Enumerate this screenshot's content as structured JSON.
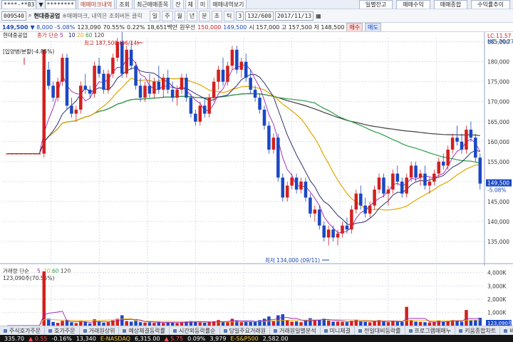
{
  "toolbar": {
    "account_field": "****-**83",
    "password_field": "********",
    "buttons": [
      {
        "label": "매매마크내역",
        "style": "red"
      },
      {
        "label": "조회",
        "style": ""
      },
      {
        "label": "최근매매종목",
        "style": ""
      },
      {
        "label": "잔",
        "style": ""
      },
      {
        "label": "체",
        "style": ""
      },
      {
        "label": "미",
        "style": ""
      },
      {
        "label": "매매내역보기",
        "style": ""
      }
    ],
    "right_buttons": [
      "일별잔고",
      "매매수익",
      "매매종합",
      "수익률추이"
    ]
  },
  "stockbar": {
    "code": "009540",
    "name": "현대중공업",
    "note": "※매매마크, 내역은 조회버튼 클릭",
    "period_buttons": [
      "일",
      "주",
      "월",
      "년",
      "분",
      "초",
      "틱"
    ],
    "period_value": "3",
    "count": "132/600",
    "date": "2017/11/13"
  },
  "pricebar": {
    "price": "149,500",
    "change": "▼ 8,000",
    "change_pct": "-5.08%",
    "volume": "123,090",
    "volume_ratio": "70.55%",
    "turnover_ratio": "0.22%",
    "amount": "18,651백만",
    "upper": "원우선",
    "open": "150,000",
    "low_label": "149,500",
    "high_info": "시 157,000 고 157,500 저 148,500",
    "buy_label": "매수",
    "sell_label": "매도"
  },
  "colors": {
    "up": "#d22020",
    "down": "#1a48c4",
    "ma5": "#a020b0",
    "ma10": "#1a1a60",
    "ma20": "#e0a800",
    "ma60": "#2e9b44",
    "ma120": "#404040",
    "grid": "#d7dce6"
  },
  "chart_data": {
    "type": "candlestick",
    "stock": "현대중공업",
    "legend": [
      {
        "label": "현대중공업",
        "color": "#222222"
      },
      {
        "label": "종가 단순",
        "color": "#c81e1e"
      },
      {
        "label": "5",
        "color": "#a020b0"
      },
      {
        "label": "10",
        "color": "#1a1a60"
      },
      {
        "label": "20",
        "color": "#e0a800"
      },
      {
        "label": "60",
        "color": "#2e9b44"
      },
      {
        "label": "120",
        "color": "#404040"
      }
    ],
    "price_axis": {
      "min": 130000,
      "max": 186000,
      "ticks": [
        135000,
        140000,
        145000,
        150000,
        155000,
        160000,
        165000,
        170000,
        175000,
        180000,
        185000
      ]
    },
    "price_tick_labels": [
      "135,000",
      "140,000",
      "145,000",
      "150,000",
      "155,000",
      "160,000",
      "165,000",
      "170,000",
      "175,000",
      "180,000",
      "185,000"
    ],
    "top_labels": [
      "LC:11.57",
      "HC:-20.27"
    ],
    "annotation_high": "최고 187,500 (06/14)",
    "annotation_low": "최저 134,000 (09/11)",
    "annotation_event": "[입양병/분할(-4.85%)",
    "current_price_label": "149,500",
    "current_change_label": "-5.08%",
    "candles": [
      [
        157,
        157,
        157,
        157
      ],
      [
        157,
        157,
        157,
        157
      ],
      [
        157,
        157,
        157,
        157
      ],
      [
        157,
        157,
        157,
        157
      ],
      [
        157,
        157,
        157,
        157
      ],
      [
        157,
        157,
        157,
        157
      ],
      [
        157,
        157,
        157,
        157
      ],
      [
        157,
        157,
        157,
        157
      ],
      [
        157,
        183,
        156,
        183
      ],
      [
        178,
        180,
        173,
        174
      ],
      [
        174,
        175,
        170,
        171
      ],
      [
        171,
        176,
        170,
        175
      ],
      [
        175,
        182,
        174,
        181
      ],
      [
        181,
        182,
        168,
        169
      ],
      [
        169,
        171,
        166,
        167
      ],
      [
        167,
        169,
        165,
        168
      ],
      [
        168,
        175,
        167,
        174
      ],
      [
        174,
        177,
        172,
        173
      ],
      [
        173,
        174,
        171,
        172
      ],
      [
        172,
        180,
        171,
        179
      ],
      [
        179,
        181,
        176,
        177
      ],
      [
        177,
        178,
        172,
        173
      ],
      [
        173,
        178,
        172,
        177
      ],
      [
        177,
        182,
        176,
        181
      ],
      [
        181,
        186,
        180,
        185
      ],
      [
        185,
        188,
        176,
        177
      ],
      [
        177,
        184,
        176,
        183
      ],
      [
        183,
        185,
        178,
        179
      ],
      [
        179,
        180,
        173,
        174
      ],
      [
        174,
        176,
        170,
        171
      ],
      [
        171,
        175,
        170,
        174
      ],
      [
        174,
        177,
        171,
        172
      ],
      [
        172,
        176,
        171,
        175
      ],
      [
        175,
        179,
        172,
        173
      ],
      [
        173,
        177,
        171,
        176
      ],
      [
        176,
        178,
        172,
        173
      ],
      [
        173,
        175,
        170,
        171
      ],
      [
        171,
        174,
        169,
        173
      ],
      [
        173,
        177,
        172,
        176
      ],
      [
        176,
        177,
        170,
        171
      ],
      [
        171,
        172,
        166,
        167
      ],
      [
        167,
        168,
        164,
        165
      ],
      [
        165,
        170,
        164,
        169
      ],
      [
        169,
        171,
        166,
        167
      ],
      [
        167,
        172,
        166,
        171
      ],
      [
        171,
        176,
        170,
        175
      ],
      [
        175,
        179,
        173,
        178
      ],
      [
        178,
        181,
        174,
        175
      ],
      [
        175,
        180,
        174,
        179
      ],
      [
        179,
        184,
        178,
        183
      ],
      [
        183,
        184,
        177,
        178
      ],
      [
        178,
        181,
        176,
        180
      ],
      [
        180,
        182,
        175,
        176
      ],
      [
        176,
        178,
        172,
        173
      ],
      [
        173,
        174,
        170,
        171
      ],
      [
        171,
        172,
        167,
        168
      ],
      [
        168,
        169,
        163,
        164
      ],
      [
        164,
        165,
        157,
        158
      ],
      [
        158,
        162,
        157,
        161
      ],
      [
        161,
        162,
        150,
        151
      ],
      [
        151,
        152,
        145,
        146
      ],
      [
        146,
        150,
        145,
        149
      ],
      [
        149,
        152,
        148,
        151
      ],
      [
        151,
        152,
        147,
        148
      ],
      [
        148,
        151,
        147,
        150
      ],
      [
        150,
        151,
        145,
        146
      ],
      [
        146,
        147,
        141,
        142
      ],
      [
        142,
        144,
        140,
        143
      ],
      [
        143,
        144,
        138,
        139
      ],
      [
        139,
        140,
        135,
        136
      ],
      [
        136,
        139,
        134,
        138
      ],
      [
        138,
        139,
        135,
        136
      ],
      [
        136,
        138,
        134,
        137
      ],
      [
        137,
        140,
        136,
        139
      ],
      [
        139,
        141,
        137,
        138
      ],
      [
        138,
        144,
        137,
        143
      ],
      [
        143,
        148,
        142,
        147
      ],
      [
        147,
        149,
        143,
        144
      ],
      [
        144,
        146,
        141,
        142
      ],
      [
        142,
        145,
        141,
        144
      ],
      [
        144,
        149,
        143,
        148
      ],
      [
        148,
        152,
        147,
        151
      ],
      [
        151,
        152,
        146,
        147
      ],
      [
        147,
        149,
        144,
        148
      ],
      [
        148,
        153,
        147,
        152
      ],
      [
        152,
        154,
        149,
        150
      ],
      [
        150,
        151,
        146,
        147
      ],
      [
        147,
        152,
        146,
        151
      ],
      [
        151,
        155,
        150,
        154
      ],
      [
        154,
        155,
        150,
        151
      ],
      [
        151,
        153,
        149,
        152
      ],
      [
        152,
        154,
        148,
        149
      ],
      [
        149,
        151,
        147,
        150
      ],
      [
        150,
        153,
        149,
        152
      ],
      [
        152,
        156,
        151,
        155
      ],
      [
        155,
        157,
        153,
        154
      ],
      [
        154,
        159,
        153,
        158
      ],
      [
        158,
        162,
        157,
        161
      ],
      [
        161,
        164,
        159,
        160
      ],
      [
        160,
        162,
        157,
        158
      ],
      [
        158,
        164,
        157,
        163
      ],
      [
        163,
        165,
        160,
        161
      ],
      [
        161,
        162,
        155,
        156
      ],
      [
        156,
        157,
        148,
        149.5
      ]
    ]
  },
  "volume_panel": {
    "title": "거래량 단순",
    "legend": [
      {
        "label": "5",
        "color": "#a020b0"
      },
      {
        "label": "20",
        "color": "#e0a800"
      },
      {
        "label": "60",
        "color": "#2e9b44"
      },
      {
        "label": "120",
        "color": "#404040"
      }
    ],
    "info": "123,090주(70.55%)",
    "axis_labels": [
      "4,000K",
      "3,000K",
      "2,000K",
      "1,000K"
    ],
    "current_label": "123,090주",
    "max_value": 4200,
    "values": [
      0,
      0,
      0,
      0,
      0,
      0,
      0,
      0,
      4100,
      520,
      280,
      210,
      360,
      420,
      250,
      190,
      330,
      270,
      160,
      480,
      310,
      220,
      260,
      390,
      520,
      780,
      340,
      300,
      410,
      260,
      230,
      250,
      210,
      280,
      200,
      240,
      230,
      190,
      260,
      300,
      350,
      280,
      240,
      220,
      260,
      330,
      420,
      300,
      280,
      520,
      380,
      260,
      350,
      320,
      290,
      410,
      520,
      690,
      330,
      780,
      860,
      410,
      300,
      330,
      260,
      420,
      560,
      390,
      450,
      520,
      380,
      300,
      310,
      280,
      260,
      360,
      440,
      300,
      280,
      250,
      380,
      420,
      300,
      260,
      340,
      290,
      270,
      1420,
      420,
      300,
      280,
      260,
      240,
      280,
      350,
      300,
      330,
      420,
      380,
      300,
      1180,
      380,
      400,
      590
    ]
  },
  "taskbar": {
    "tabs": [
      "주식호가주문",
      "호가주문",
      "거래원상위",
      "예상체결등락률",
      "시간외등락률순",
      "당일주요거래원",
      "거래원일별분석",
      "미니체결",
      "전일대비등락률",
      "프로그램매매누",
      "키움종합차트",
      "바로"
    ]
  },
  "ticker": {
    "items": [
      "335.70",
      "▲ 0.55",
      "-0.16%",
      "13,340",
      "E-NASDAQ",
      "6,315.00",
      "▲ 5.75",
      "0.09%",
      "3,979",
      "E-S&P500",
      "2,582.00"
    ]
  }
}
